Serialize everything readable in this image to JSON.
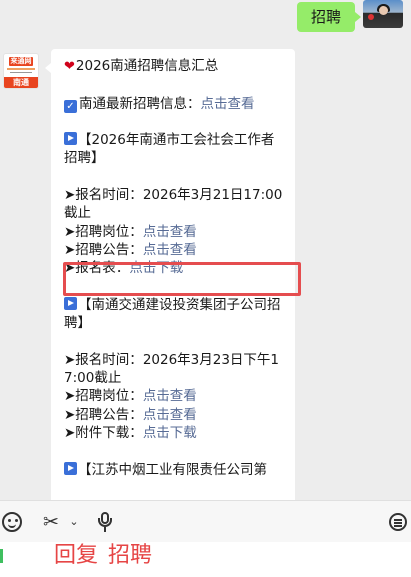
{
  "outgoing": {
    "text": "招聘"
  },
  "bot": {
    "logo_top": "来通网",
    "logo_bottom": "南通"
  },
  "message": {
    "header": "2026南通招聘信息汇总",
    "latest_label": "南通最新招聘信息：",
    "latest_link": "点击查看",
    "items": [
      {
        "title": "【2026年南通市工会社会工作者招聘】",
        "time_label": "➤报名时间：",
        "time_value": "2026年3月21日17:00截止",
        "post_label": "➤招聘岗位：",
        "post_link": "点击查看",
        "notice_label": "➤招聘公告：",
        "notice_link": "点击查看",
        "form_label": "➤报名表：",
        "form_link": "点击下载"
      },
      {
        "title": "【南通交通建设投资集团子公司招聘】",
        "time_label": "➤报名时间：",
        "time_value": "2026年3月23日下午17:00截止",
        "post_label": "➤招聘岗位：",
        "post_link": "点击查看",
        "notice_label": "➤招聘公告：",
        "notice_link": "点击查看",
        "attach_label": "➤附件下载：",
        "attach_link": "点击下载"
      },
      {
        "title": "【江苏中烟工业有限责任公司第"
      }
    ]
  },
  "footer": {
    "reply_label": "回复",
    "reply_keyword": "招聘"
  },
  "icons": {
    "heart": "heart-icon",
    "check": "checkbox-icon",
    "play": "play-icon",
    "emoji": "emoji-icon",
    "scissors": "scissors-icon",
    "chevron": "chevron-down-icon",
    "mic": "microphone-icon",
    "keyboard": "keyboard-icon"
  },
  "colors": {
    "outgoing_bubble": "#95ec69",
    "link": "#576b95",
    "highlight": "#e54d4f",
    "reply_text": "#e64545"
  }
}
